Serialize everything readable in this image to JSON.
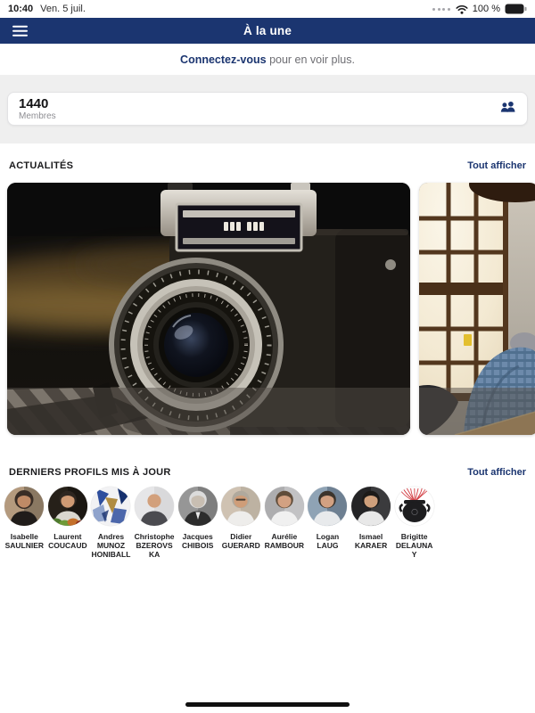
{
  "colors": {
    "brand_navy": "#1b3570",
    "band_gray": "#efefef"
  },
  "status_bar": {
    "time": "10:40",
    "date": "Ven. 5 juil.",
    "battery_percent": "100 %",
    "cellular_icon": "signal-dots",
    "wifi_icon": "wifi"
  },
  "header": {
    "title": "À la une",
    "menu_icon": "hamburger"
  },
  "login_banner": {
    "link_text": "Connectez-vous",
    "suffix_text": " pour en voir plus."
  },
  "stats_card": {
    "value": "1440",
    "label": "Membres",
    "icon": "members-icon"
  },
  "sections": {
    "news": {
      "title": "ACTUALITÉS",
      "action_label": "Tout afficher",
      "images": [
        {
          "alt": "vintage-camera-photo"
        },
        {
          "alt": "office-window-photo"
        }
      ]
    },
    "profiles": {
      "title": "DERNIERS PROFILS MIS À JOUR",
      "action_label": "Tout afficher",
      "items": [
        {
          "name": "Isabelle SAULNIER",
          "avatar": {
            "variant": "person",
            "bg": "#b49a7e",
            "bg2": "#8a7862",
            "hair": "#392d26",
            "hairR": 10.5,
            "skin": "#bf8a66",
            "shirt": "#201c1a"
          }
        },
        {
          "name": "Laurent COUCAUD",
          "avatar": {
            "variant": "person",
            "bg": "#262019",
            "bg2": "#1b1712",
            "hair": "#2e2620",
            "skin": "#cf9a74",
            "shirt": "#dad7cf",
            "accents": [
              "#4e7a2e",
              "#6f9a38",
              "#c4702b",
              "#8a2f1f"
            ]
          }
        },
        {
          "name": "Andres MUNOZ HONIBALL",
          "avatar": {
            "variant": "abstract",
            "bg": "#f2f2f4",
            "accents": [
              "#2f4f9e",
              "#8fa3cc",
              "#16306e",
              "#b08c42"
            ]
          }
        },
        {
          "name": "Christophe BZEROVSKA",
          "avatar": {
            "variant": "person",
            "bg": "#e6e6e8",
            "bg2": "#d9d9db",
            "skin": "#d2a07c",
            "shirt": "#4b4b50"
          }
        },
        {
          "name": "Jacques CHIBOIS",
          "avatar": {
            "variant": "person",
            "bg": "#969696",
            "bg2": "#7e7e7e",
            "hair": "#dcdcdc",
            "skin": "#c8beb2",
            "shirt": "#2c2c2c",
            "tie": "#e8e8e8"
          }
        },
        {
          "name": "Didier GUERARD",
          "avatar": {
            "variant": "person",
            "bg": "#cfc2b2",
            "bg2": "#bdb2a2",
            "hair": "#b0a99d",
            "skin": "#cf9d78",
            "shirt": "#eeedeb",
            "glasses": "#2e2a26"
          }
        },
        {
          "name": "Aurélie RAMBOUR",
          "avatar": {
            "variant": "person",
            "bg": "#adadaf",
            "bg2": "#c2c2c4",
            "hair": "#5f4c3a",
            "skin": "#d2a182",
            "shirt": "#f0f0f0"
          }
        },
        {
          "name": "Logan LAUG",
          "avatar": {
            "variant": "person",
            "bg": "#8fa3b5",
            "bg2": "#6e8092",
            "hair": "#3c342c",
            "skin": "#d2a182",
            "shirt": "#e8eaec"
          }
        },
        {
          "name": "Ismael KARAER",
          "avatar": {
            "variant": "person",
            "bg": "#242426",
            "bg2": "#3b3b3d",
            "hair": "#1c1a18",
            "skin": "#cfa07c",
            "shirt": "#e8e8e8"
          }
        },
        {
          "name": "Brigitte DELAUNAY",
          "avatar": {
            "variant": "pot",
            "bg": "#ffffff",
            "pot": "#1d1d1f",
            "strand": "#d23c42"
          }
        }
      ]
    }
  }
}
